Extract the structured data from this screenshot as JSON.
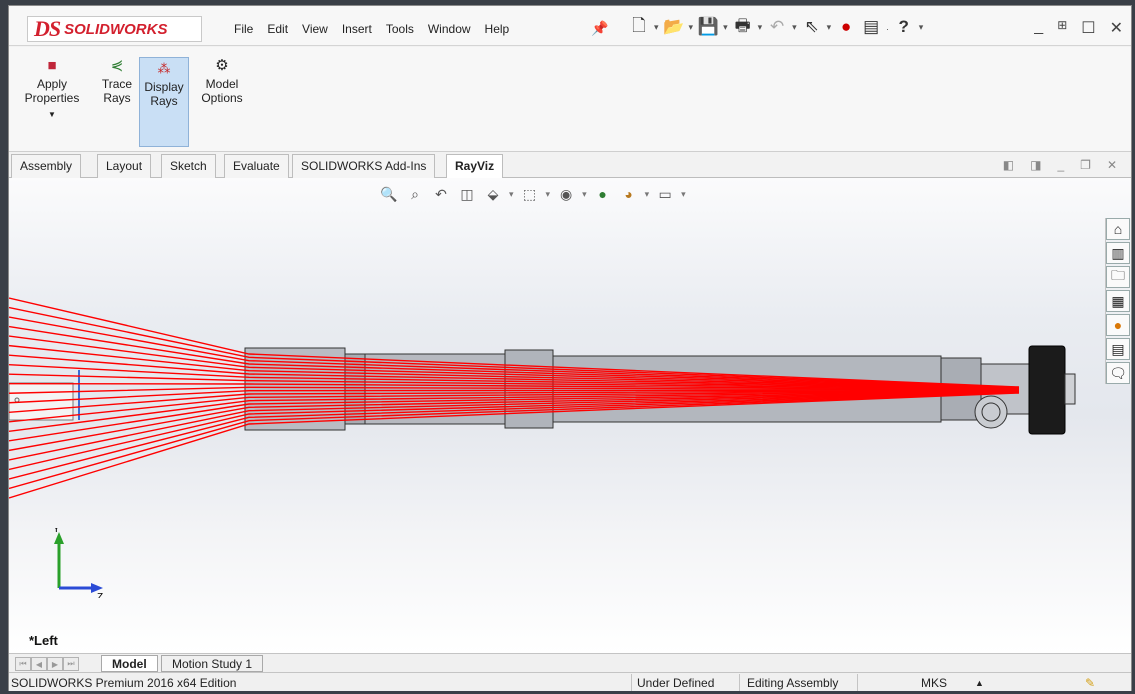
{
  "title_bar": {
    "logo_mark": "DS",
    "logo_text": "SOLIDWORKS",
    "menu": [
      "File",
      "Edit",
      "View",
      "Insert",
      "Tools",
      "Window",
      "Help"
    ],
    "quick_access_icons": [
      "new-document-icon",
      "open-icon",
      "save-icon",
      "print-icon",
      "undo-icon",
      "select-icon",
      "rebuild-icon",
      "file-properties-icon",
      "help-icon"
    ],
    "help_label": "?"
  },
  "command_manager": {
    "buttons": [
      {
        "line1": "Apply",
        "line2": "Properties",
        "icon": "apply-properties-icon"
      },
      {
        "line1": "Trace",
        "line2": "Rays",
        "icon": "trace-rays-icon"
      },
      {
        "line1": "Display",
        "line2": "Rays",
        "icon": "display-rays-icon",
        "active": true
      },
      {
        "line1": "Model",
        "line2": "Options",
        "icon": "gear-icon"
      }
    ]
  },
  "tabs": [
    "Assembly",
    "Layout",
    "Sketch",
    "Evaluate",
    "SOLIDWORKS Add-Ins",
    "RayViz"
  ],
  "active_tab": "RayViz",
  "viewport": {
    "view_name": "*Left",
    "triad": {
      "y": "Y",
      "z": "Z"
    },
    "ray_color": "#ff0000"
  },
  "model_tabs": [
    "Model",
    "Motion Study 1"
  ],
  "status_bar": {
    "edition": "SOLIDWORKS Premium 2016 x64 Edition",
    "state": "Under Defined",
    "mode": "Editing Assembly",
    "units": "MKS",
    "units_arrow": "▲"
  }
}
